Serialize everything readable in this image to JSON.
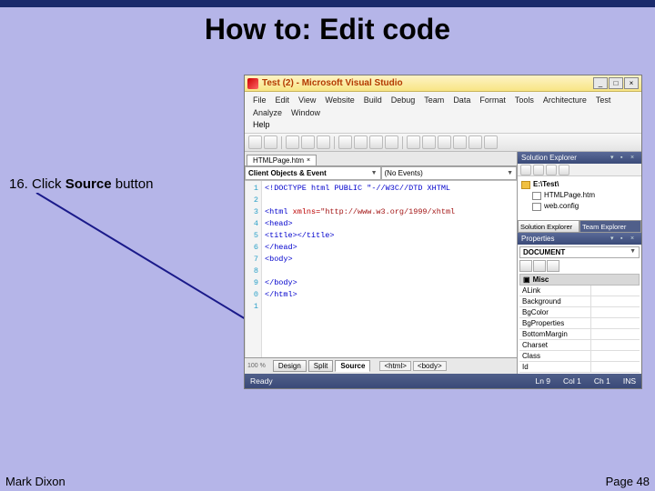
{
  "slide": {
    "title": "How to: Edit code",
    "instruction_num": "16. ",
    "instruction_pre": "Click ",
    "instruction_bold": "Source",
    "instruction_post": " button",
    "footer_author": "Mark Dixon",
    "footer_page": "Page 48"
  },
  "vs": {
    "title": "Test (2) - Microsoft Visual Studio",
    "menu": [
      "File",
      "Edit",
      "View",
      "Website",
      "Build",
      "Debug",
      "Team",
      "Data",
      "Format",
      "Tools",
      "Architecture",
      "Test",
      "Analyze",
      "Window"
    ],
    "menu_help": "Help",
    "doc_tab": "HTMLPage.htm",
    "dropdowns": {
      "left": "Client Objects & Event",
      "right": "(No Events)"
    },
    "code": {
      "line1": "<!DOCTYPE html PUBLIC \"-//W3C//DTD XHTML",
      "line3": "<html xmlns=\"http://www.w3.org/1999/xhtml",
      "line4": "<head>",
      "line5": "    <title></title>",
      "line6": "</head>",
      "line7": "<body>",
      "line9": "</body>",
      "line10": "</html>"
    },
    "gutter": [
      "1",
      "2",
      "3",
      "4",
      "5",
      "6",
      "7",
      "8",
      "9",
      "0",
      "1"
    ],
    "viewtabs": {
      "design": "Design",
      "split": "Split",
      "source": "Source",
      "crumb_html": "<html>",
      "crumb_body": "<body>"
    },
    "status": {
      "ready": "Ready",
      "ln": "Ln 9",
      "col": "Col 1",
      "ch": "Ch 1",
      "ins": "INS"
    },
    "solution": {
      "title": "Solution Explorer",
      "root": "E:\\Test\\",
      "item1": "HTMLPage.htm",
      "item2": "web.config",
      "tab_sol": "Solution Explorer",
      "tab_team": "Team Explorer"
    },
    "properties": {
      "title": "Properties",
      "selected": "DOCUMENT",
      "group": "Misc",
      "rows": [
        "ALink",
        "Background",
        "BgColor",
        "BgProperties",
        "BottomMargin",
        "Charset",
        "Class",
        "Id"
      ]
    }
  }
}
